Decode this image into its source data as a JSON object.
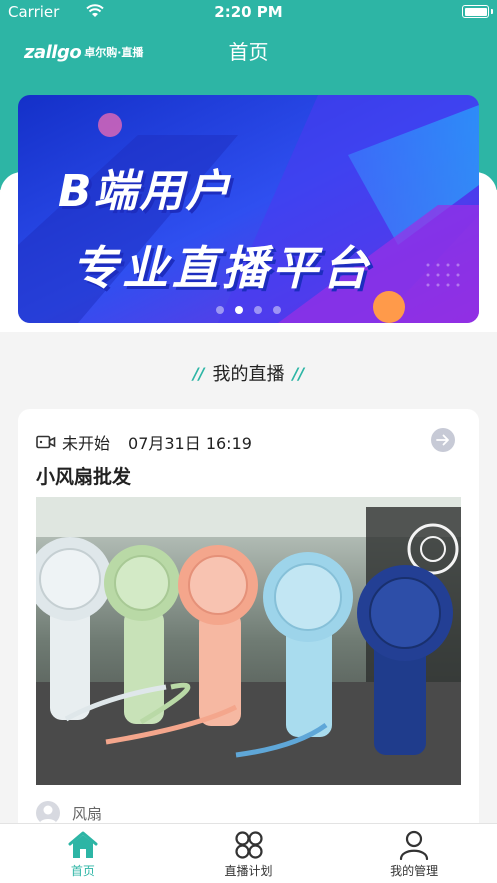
{
  "status_bar": {
    "carrier": "Carrier",
    "time": "2:20 PM"
  },
  "header": {
    "logo_mark": "zallgo",
    "logo_sub": "卓尔购·直播",
    "title": "首页"
  },
  "banner": {
    "line1": "B端用户",
    "line2": "专业直播平台",
    "slides_count": 4,
    "active_slide": 2
  },
  "section": {
    "title": "我的直播"
  },
  "live_card": {
    "status": "未开始",
    "datetime": "07月31日 16:19",
    "title": "小风扇批发",
    "owner": "风扇"
  },
  "tabbar": {
    "items": [
      {
        "label": "首页",
        "icon": "home-icon",
        "active": true
      },
      {
        "label": "直播计划",
        "icon": "grid-icon",
        "active": false
      },
      {
        "label": "我的管理",
        "icon": "person-icon",
        "active": false
      }
    ]
  },
  "colors": {
    "brand": "#2db5a5",
    "banner_blue": "#2a3fe0",
    "banner_purple": "#8a2be2"
  }
}
